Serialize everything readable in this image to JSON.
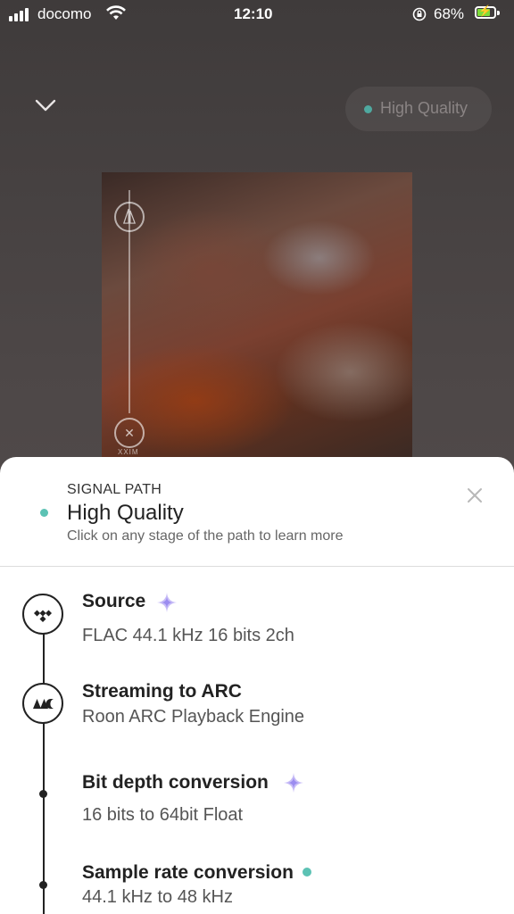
{
  "status_bar": {
    "carrier": "docomo",
    "time": "12:10",
    "battery_percent": "68%"
  },
  "header": {
    "quality_pill_label": "High Quality"
  },
  "album_art": {
    "label_text": "XXIM"
  },
  "signal_path": {
    "eyebrow": "SIGNAL PATH",
    "title": "High Quality",
    "subtitle": "Click on any stage of the path to learn more",
    "colors": {
      "quality_dot": "#5cc2b4",
      "sparkle": "#9b8cf0"
    },
    "stages": [
      {
        "title": "Source",
        "detail": "FLAC 44.1 kHz 16 bits 2ch",
        "icon": "tidal-icon",
        "badge": "sparkle"
      },
      {
        "title": "Streaming to ARC",
        "detail": "Roon ARC Playback Engine",
        "icon": "arc-icon"
      },
      {
        "title": "Bit depth conversion",
        "detail": "16 bits to 64bit Float",
        "badge": "sparkle"
      },
      {
        "title": "Sample rate conversion",
        "detail": "44.1 kHz to 48 kHz",
        "badge": "dot"
      }
    ]
  }
}
